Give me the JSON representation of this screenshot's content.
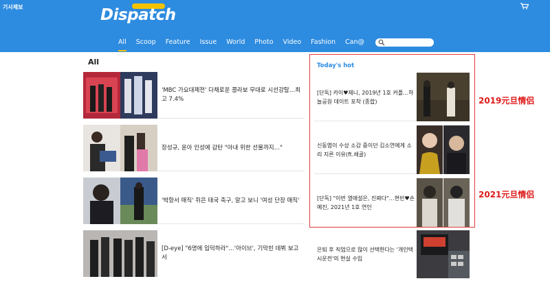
{
  "header": {
    "report_link": "기사제보",
    "logo": "Dispatch",
    "nav": [
      "All",
      "Scoop",
      "Feature",
      "Issue",
      "World",
      "Photo",
      "Video",
      "Fashion",
      "Can@"
    ],
    "search_placeholder": ""
  },
  "main": {
    "section_title": "All",
    "articles": [
      {
        "title": "'MBC 가요대제전' 다채로운 콜라보 무대로 시선강탈…최고 7.4%"
      },
      {
        "title": "장성규, 윤아 인성에 감탄 \"아내 위한 선물까지…\""
      },
      {
        "title": "'박항서 매직' 쥐은 태국 축구, 알고 보니 '여성 단장 매직'"
      },
      {
        "title": "[D-eye] \"6명에 입덕하라\"…'아이브', 기막힌 데뷔 보고서"
      }
    ]
  },
  "hot": {
    "title": "Today's hot",
    "items": [
      {
        "title": "[단독] 카이♥제니, 2019년 1호 커플…하늘공원 데이트 포착 (종합)"
      },
      {
        "title": "신동엽이 수상 소감 중이던 김소연에게 소리 지른 이유(ft.쇄골)"
      },
      {
        "title": "[단독] \"이번 열애설은, 진짜다\"…현빈♥손예진, 2021년 1호 연인"
      }
    ],
    "bottom_item": {
      "title": "은퇴 후 직업으로 많이 선택한다는 '개인택시운전'의 현실 수입"
    }
  },
  "annotations": {
    "first": "2019元旦情侣",
    "second": "2021元旦情侣"
  },
  "colors": {
    "header_bg": "#2d8be0",
    "accent_yellow": "#f2c200",
    "hot_title": "#2d8be0",
    "annotation_red": "#e01a1a"
  }
}
